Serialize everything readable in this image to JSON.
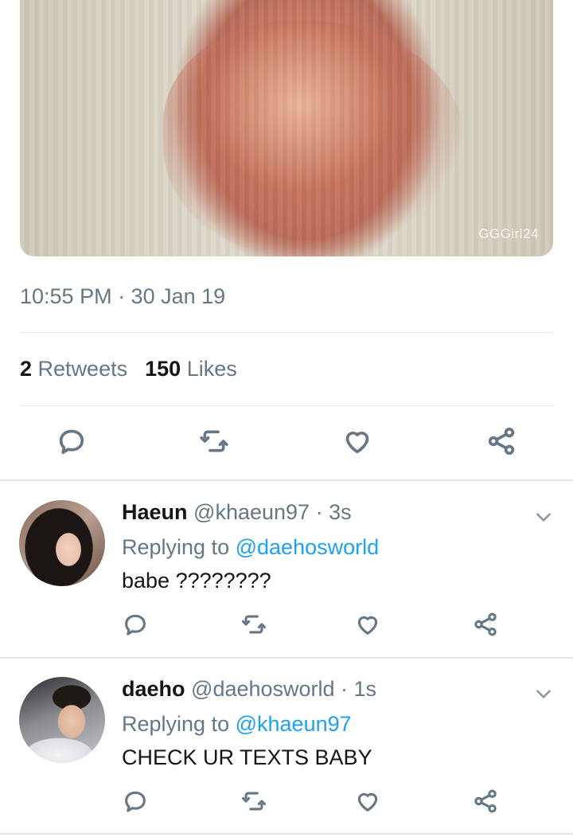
{
  "media": {
    "watermark": "GGGirl24"
  },
  "tweet": {
    "timestamp": "10:55 PM · 30 Jan 19",
    "retweets_count": "2",
    "retweets_label": "Retweets",
    "likes_count": "150",
    "likes_label": "Likes"
  },
  "actions": [
    "reply-icon",
    "retweet-icon",
    "like-icon",
    "share-icon"
  ],
  "replies": [
    {
      "display_name": "Haeun",
      "meta": "@khaeun97 · 3s",
      "replying_prefix": "Replying to",
      "replying_to": "@daehosworld",
      "text": "babe ????????"
    },
    {
      "display_name": "daeho",
      "meta": "@daehosworld · 1s",
      "replying_prefix": "Replying to",
      "replying_to": "@khaeun97",
      "text": "CHECK UR TEXTS BABY"
    }
  ],
  "colors": {
    "accent": "#1da1f2",
    "secondary_text": "#657786",
    "divider": "#e1e8ed"
  }
}
